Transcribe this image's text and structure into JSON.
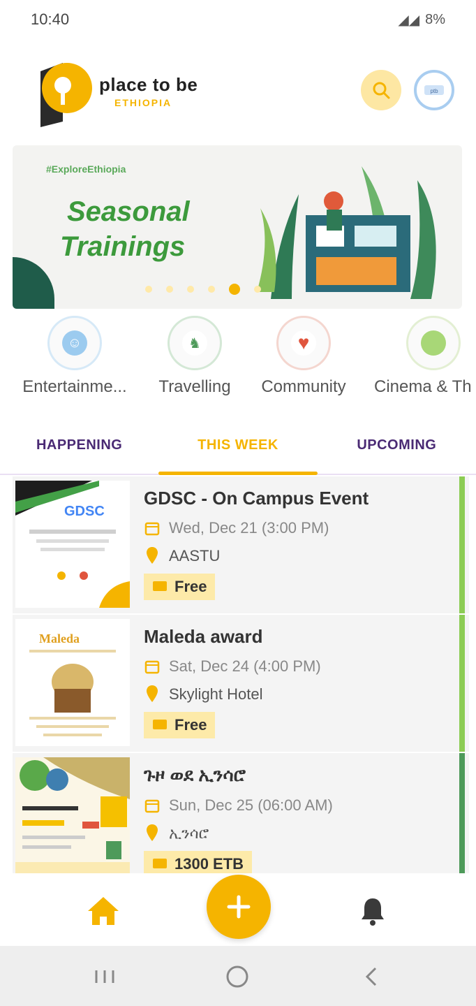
{
  "status_bar": {
    "time": "10:40",
    "battery": "8%"
  },
  "header": {
    "logo_title": "place to be",
    "logo_subtitle": "ETHIOPIA",
    "search_icon": "search-icon",
    "avatar_icon": "avatar-icon"
  },
  "banner": {
    "tag": "#ExploreEthiopia",
    "title_line1": "Seasonal",
    "title_line2": "Trainings",
    "slides": 6,
    "active_slide": 4
  },
  "categories": [
    {
      "label": "Entertainme...",
      "color": "#4aa3e0",
      "icon": "smile-icon"
    },
    {
      "label": "Travelling",
      "color": "#4e9a5a",
      "icon": "hiker-icon"
    },
    {
      "label": "Community",
      "color": "#e0553d",
      "icon": "heart-icon"
    },
    {
      "label": "Cinema & Th",
      "color": "#8ccc54",
      "icon": "film-icon"
    }
  ],
  "tabs": [
    {
      "label": "HAPPENING"
    },
    {
      "label": "THIS WEEK"
    },
    {
      "label": "UPCOMING"
    }
  ],
  "events": [
    {
      "title": "GDSC - On Campus Event",
      "date": "Wed, Dec 21 (3:00 PM)",
      "location": "AASTU",
      "price": "Free",
      "bar_color": "#8ccc54"
    },
    {
      "title": "Maleda award",
      "date": "Sat, Dec 24 (4:00 PM)",
      "location": "Skylight Hotel",
      "price": "Free",
      "bar_color": "#8ccc54"
    },
    {
      "title": "ጉዞ ወደ ኢንሳሮ",
      "date": "Sun, Dec 25 (06:00 AM)",
      "location": "ኢንሳሮ",
      "price": "1300 ETB",
      "bar_color": "#4e9a5a"
    }
  ],
  "colors": {
    "accent": "#f5b400",
    "tab_text": "#4a2a74"
  }
}
